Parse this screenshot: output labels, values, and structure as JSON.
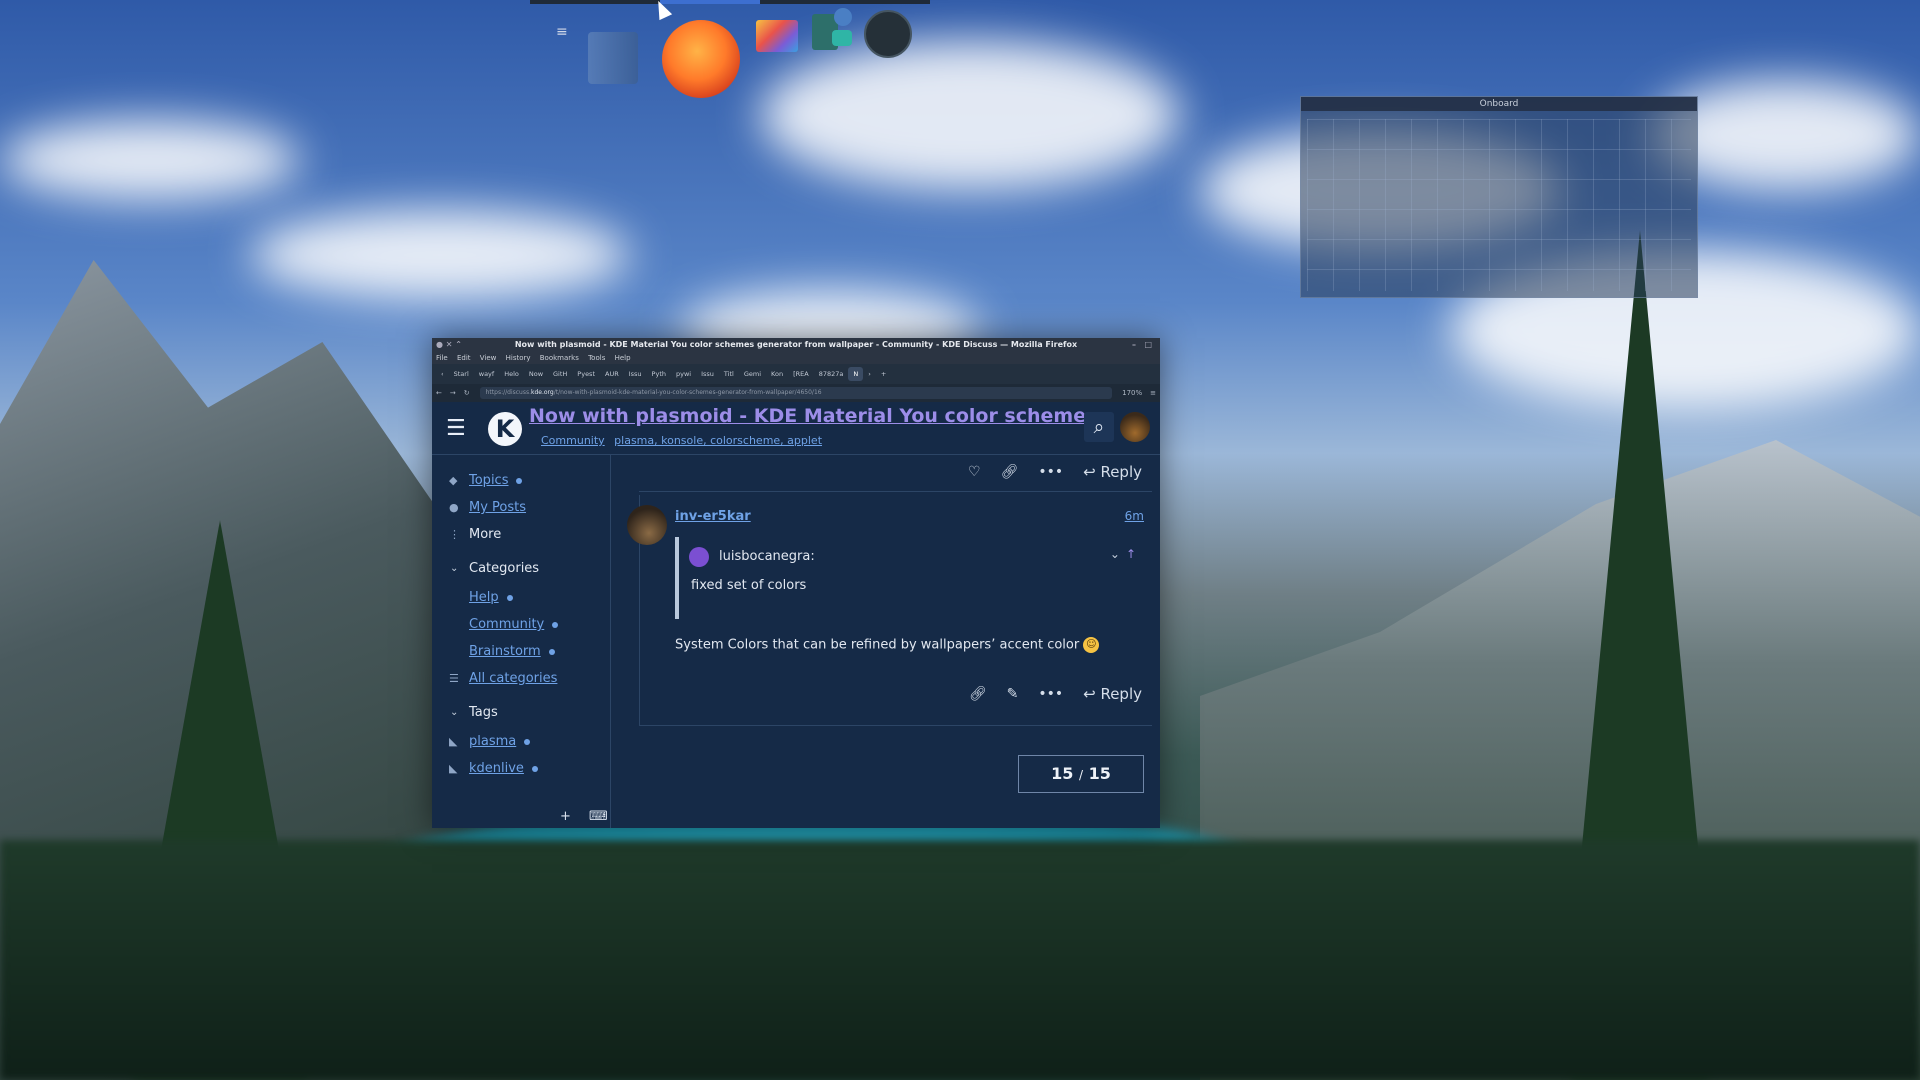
{
  "dock": {
    "menu_icon": "menu-icon",
    "apps": [
      "columns-app-icon",
      "firefox-icon",
      "file-manager-icon",
      "screenshot-icon",
      "clock-icon"
    ]
  },
  "onboard": {
    "title": "Onboard"
  },
  "window": {
    "title": "Now with plasmoid - KDE Material You color schemes generator from wallpaper - Community - KDE Discuss — Mozilla Firefox",
    "menu": [
      "File",
      "Edit",
      "View",
      "History",
      "Bookmarks",
      "Tools",
      "Help"
    ],
    "tabs": [
      "Starl",
      "wayf",
      "Helo",
      "Now",
      "GitH",
      "Pyest",
      "AUR",
      "Issu",
      "Pyth",
      "pywi",
      "Issu",
      "Titl",
      "Gemi",
      "Kon",
      "[REA",
      "87827a",
      "N"
    ],
    "url_prefix": "https://discuss.",
    "url_domain": "kde.org",
    "url_rest": "/t/now-with-plasmoid-kde-material-you-color-schemes-generator-from-wallpaper/4650/16",
    "zoom": "170%"
  },
  "page": {
    "title": "Now with plasmoid - KDE Material You color scheme...",
    "category": "Community",
    "tags": "plasma, konsole, colorscheme, applet"
  },
  "sidebar": {
    "topics": "Topics",
    "my_posts": "My Posts",
    "more": "More",
    "categories_heading": "Categories",
    "categories": [
      "Help",
      "Community",
      "Brainstorm"
    ],
    "all_categories": "All categories",
    "tags_heading": "Tags",
    "tags": [
      "plasma",
      "kdenlive"
    ]
  },
  "post": {
    "reply_label": "Reply",
    "username": "inv-er5kar",
    "age": "6m",
    "quote_user": "luisbocanegra:",
    "quote_text": "fixed set of colors",
    "body": "System Colors that can be refined by wallpapers’ accent color"
  },
  "progress": {
    "current": "15",
    "sep": "/",
    "total": "15"
  },
  "colors": {
    "page_bg": "#152a47",
    "link": "#6fa2e6",
    "title": "#9c8de8"
  }
}
